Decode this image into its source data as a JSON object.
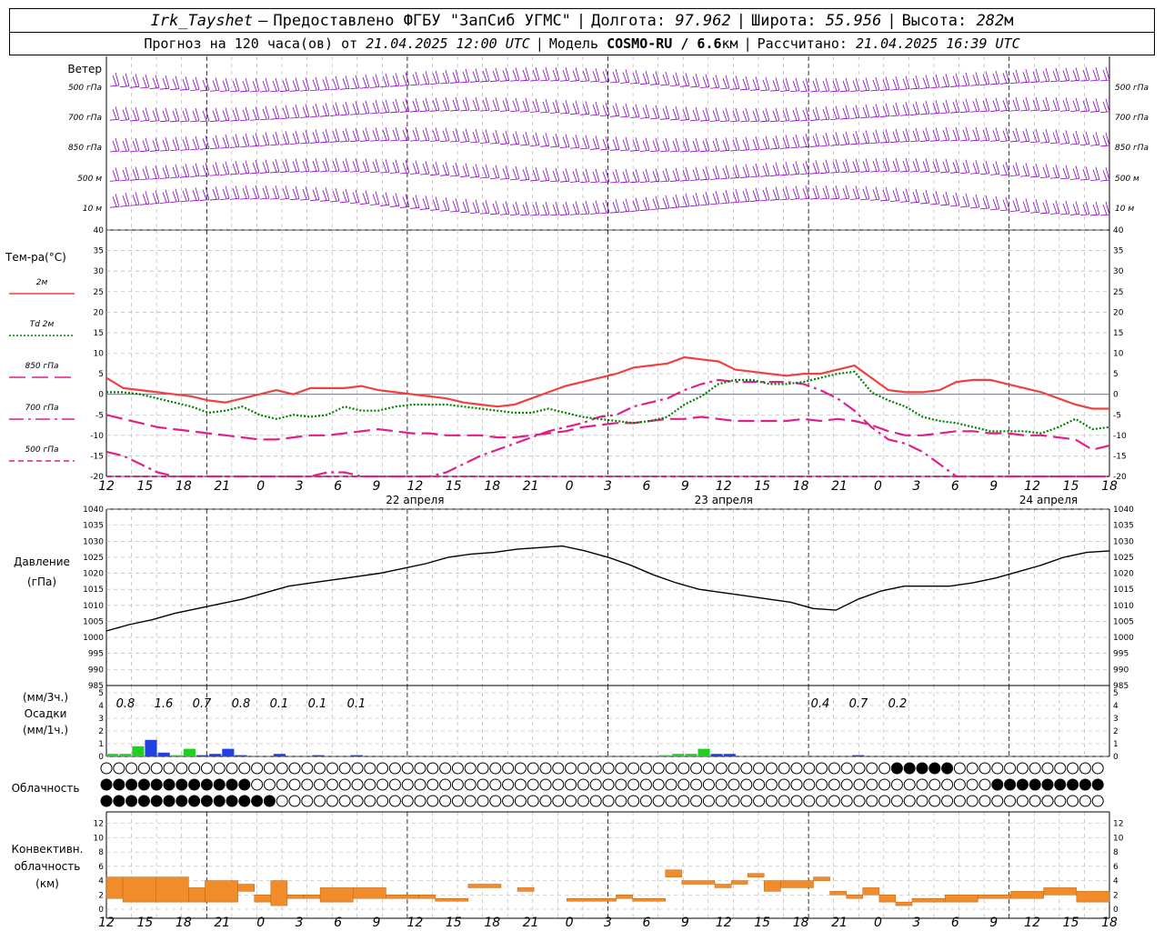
{
  "header": {
    "station": "Irk_Tayshet",
    "dash": "–",
    "provider": "Предоставлено ФГБУ \"ЗапСиб УГМС\"",
    "lon_label": "Долгота:",
    "lon": "97.962",
    "lat_label": "Широта:",
    "lat": "55.956",
    "alt_label": "Высота:",
    "alt": "282",
    "alt_unit": "м",
    "forecast_label": "Прогноз на 120 часа(ов) от",
    "forecast_start": "21.04.2025 12:00 UTC",
    "model_label": "Модель",
    "model": "COSMO-RU / 6.6",
    "model_unit": "км",
    "computed_label": "Рассчитано:",
    "computed": "21.04.2025 16:39 UTC"
  },
  "labels": {
    "wind": "Ветер",
    "levels": [
      "500 гПа",
      "700 гПа",
      "850 гПа",
      "500 м",
      "10 м"
    ],
    "temp": "Тем-ра(°C)",
    "legend": [
      {
        "name": "2м",
        "color": "#f04040",
        "dash": "solid"
      },
      {
        "name": "Td 2м",
        "color": "#008000",
        "dash": "dot"
      },
      {
        "name": "850 гПа",
        "color": "#e0208a",
        "dash": "long"
      },
      {
        "name": "700 гПа",
        "color": "#e0208a",
        "dash": "dashdot"
      },
      {
        "name": "500 гПа",
        "color": "#e0208a",
        "dash": "short"
      }
    ],
    "pressure": [
      "Давление",
      "(гПа)"
    ],
    "precip": [
      "(мм/3ч.)",
      "Осадки",
      "(мм/1ч.)"
    ],
    "cloud": "Облачность",
    "conv": [
      "Конвективн.",
      "облачность",
      "(км)"
    ],
    "dates": [
      "22 апреля",
      "23 апреля",
      "24 апреля"
    ]
  },
  "colors": {
    "wind": "#8a00c8",
    "pressure": "#000000",
    "precip_green": "#20d020",
    "precip_blue": "#2040e0",
    "conv": "#f08c2a"
  },
  "chart_data": {
    "type": "line",
    "x_hours": [
      "12",
      "15",
      "18",
      "21",
      "0",
      "3",
      "6",
      "9",
      "12",
      "15",
      "18",
      "21",
      "0",
      "3",
      "6",
      "9",
      "12",
      "15",
      "18",
      "21",
      "0",
      "3",
      "6",
      "9",
      "12",
      "15",
      "18"
    ],
    "temperature": {
      "ylim": [
        -20,
        40
      ],
      "ticks": [
        40,
        35,
        30,
        25,
        20,
        15,
        10,
        5,
        0,
        -5,
        -10,
        -15,
        -20
      ],
      "t2m": [
        4,
        1.5,
        1,
        0.5,
        0,
        -0.5,
        -1.5,
        -2,
        -1,
        0,
        1,
        0,
        1.5,
        1.5,
        1.5,
        2,
        1,
        0.5,
        0,
        -0.5,
        -1,
        -2,
        -2.5,
        -3,
        -2.5,
        -1,
        0.5,
        2,
        3,
        4,
        5,
        6.5,
        7,
        7.5,
        9,
        8.5,
        8,
        6,
        5.5,
        5,
        4.5,
        5,
        5,
        6,
        7,
        4,
        1,
        0.5,
        0.5,
        1,
        3,
        3.5,
        3.5,
        2.5,
        1.5,
        0.5,
        -1,
        -2.5,
        -3.5,
        -3.5
      ],
      "td2m": [
        0.5,
        0.5,
        0,
        -1,
        -2,
        -3,
        -4.5,
        -4,
        -3,
        -5,
        -6,
        -5,
        -5.5,
        -5,
        -3,
        -4,
        -4,
        -3,
        -2.5,
        -2.5,
        -2.5,
        -3,
        -3.5,
        -4,
        -4.5,
        -4.5,
        -3.5,
        -4.5,
        -5.5,
        -6,
        -6.5,
        -7,
        -6.5,
        -5.5,
        -2.5,
        -0.5,
        2.5,
        3.5,
        3.5,
        2.5,
        2.5,
        3,
        4,
        5,
        5.5,
        0.5,
        -1.5,
        -3,
        -5.5,
        -6.5,
        -7,
        -8,
        -9,
        -9,
        -9,
        -9.5,
        -8,
        -6,
        -8.5,
        -8
      ],
      "t850": [
        -5,
        -6,
        -7,
        -8,
        -8.5,
        -9,
        -9.5,
        -10,
        -10.5,
        -11,
        -11,
        -10.5,
        -10,
        -10,
        -9.5,
        -9,
        -8.5,
        -9,
        -9.5,
        -9.5,
        -10,
        -10,
        -10,
        -10.5,
        -10.5,
        -10,
        -9.5,
        -9,
        -8,
        -7.5,
        -7,
        -7,
        -6.5,
        -6,
        -6,
        -5.5,
        -6,
        -6.5,
        -6.5,
        -6.5,
        -6.5,
        -6,
        -6.5,
        -6,
        -6.5,
        -7.5,
        -9,
        -10,
        -10,
        -9.5,
        -9,
        -9,
        -9.5,
        -9.5,
        -10,
        -10,
        -10.5,
        -11,
        -13.5,
        -12.5
      ],
      "t700": [
        -14,
        -15,
        -17,
        -19,
        -20,
        -20.5,
        -21,
        -21.5,
        -22,
        -22.5,
        -23,
        -22,
        -20,
        -19,
        -19,
        -20,
        -21,
        -22,
        -22.5,
        -21.5,
        -19,
        -17,
        -15,
        -13.5,
        -12,
        -10.5,
        -9,
        -8,
        -7,
        -5.5,
        -5,
        -3,
        -2,
        -1,
        1,
        2.5,
        3.5,
        3,
        3,
        3,
        3,
        2.5,
        1,
        -1,
        -4,
        -8,
        -11,
        -12,
        -14,
        -17,
        -20,
        -22,
        -23,
        -24,
        -25,
        -26,
        -27,
        -28,
        -29,
        -30
      ],
      "t500": [
        -30,
        -31,
        -31,
        -32,
        -32,
        -32.5,
        -33,
        -33,
        -33,
        -33,
        -33,
        -33,
        -33,
        -32.5,
        -32,
        -31.5,
        -31,
        -30.5,
        -30,
        -29,
        -28,
        -27,
        -26,
        -25,
        -24,
        -23,
        -22,
        -22,
        -21.5,
        -21,
        -21,
        -21,
        -21,
        -21,
        -21,
        -21,
        -21,
        -21.5,
        -22,
        -22,
        -22.5,
        -23,
        -23,
        -23.5,
        -24,
        -24.5,
        -25,
        -25.5,
        -26,
        -26.5,
        -27,
        -27.5,
        -28,
        -28.5,
        -29,
        -29.5,
        -30,
        -30,
        -30.5,
        -31
      ]
    },
    "pressure": {
      "ylim": [
        985,
        1040
      ],
      "ticks": [
        1040,
        1035,
        1030,
        1025,
        1020,
        1015,
        1010,
        1005,
        1000,
        995,
        990,
        985
      ],
      "values": [
        1002,
        1004,
        1005.5,
        1007.5,
        1009,
        1010.5,
        1012,
        1014,
        1016,
        1017,
        1018,
        1019,
        1020,
        1021.5,
        1023,
        1025,
        1026,
        1026.5,
        1027.5,
        1028,
        1028.5,
        1027,
        1025,
        1022.5,
        1019.5,
        1017,
        1015,
        1014,
        1013,
        1012,
        1011,
        1009,
        1008.5,
        1012,
        1014.5,
        1016,
        1016,
        1016,
        1017,
        1018.5,
        1020.5,
        1022.5,
        1025,
        1026.5,
        1027
      ]
    },
    "precip": {
      "ylim": [
        0,
        5
      ],
      "labels_3h": [
        "0.8",
        "1.6",
        "0.7",
        "0.8",
        "0.1",
        "0.1",
        "0.1",
        "0.4",
        "0.7",
        "0.2"
      ],
      "bars": [
        [
          0,
          0.2,
          "g"
        ],
        [
          1,
          0.2,
          "g"
        ],
        [
          2,
          0.8,
          "g"
        ],
        [
          3,
          1.3,
          "b"
        ],
        [
          4,
          0.3,
          "b"
        ],
        [
          5,
          0.1,
          "g"
        ],
        [
          6,
          0.6,
          "g"
        ],
        [
          7,
          0.1,
          "b"
        ],
        [
          8,
          0.2,
          "b"
        ],
        [
          9,
          0.6,
          "b"
        ],
        [
          10,
          0.1,
          "b"
        ],
        [
          13,
          0.2,
          "b"
        ],
        [
          16,
          0.1,
          "b"
        ],
        [
          19,
          0.1,
          "b"
        ],
        [
          43,
          0.1,
          "g"
        ],
        [
          44,
          0.2,
          "g"
        ],
        [
          45,
          0.2,
          "g"
        ],
        [
          46,
          0.6,
          "g"
        ],
        [
          47,
          0.2,
          "b"
        ],
        [
          48,
          0.2,
          "b"
        ],
        [
          58,
          0.1,
          "b"
        ]
      ],
      "ticks": [
        5,
        4,
        3,
        2,
        1,
        0
      ]
    },
    "conv_cloud": {
      "ylim": [
        0,
        14
      ],
      "ticks": [
        12,
        10,
        8,
        6,
        4,
        2,
        0
      ],
      "segments": [
        [
          0,
          1,
          1.5,
          4.5
        ],
        [
          1,
          3,
          1,
          4.5
        ],
        [
          3,
          5,
          1,
          4.5
        ],
        [
          5,
          6,
          1,
          3
        ],
        [
          6,
          8,
          1,
          4
        ],
        [
          8,
          9,
          2.5,
          3.5
        ],
        [
          9,
          10,
          1,
          2
        ],
        [
          10,
          11,
          0.5,
          4
        ],
        [
          11,
          12,
          1.5,
          2
        ],
        [
          12,
          13,
          1.5,
          2
        ],
        [
          13,
          15,
          1,
          3
        ],
        [
          15,
          17,
          1.5,
          3
        ],
        [
          17,
          19,
          1.5,
          2
        ],
        [
          19,
          20,
          1.5,
          2
        ],
        [
          20,
          22,
          1.5,
          1.5
        ],
        [
          22,
          24,
          3,
          3.5
        ],
        [
          25,
          26,
          2.5,
          3
        ],
        [
          28,
          31,
          1.5,
          1.5
        ],
        [
          31,
          32,
          1.5,
          2
        ],
        [
          32,
          34,
          1.5,
          1.5
        ],
        [
          34,
          35,
          4.5,
          5.5
        ],
        [
          35,
          37,
          3.5,
          4
        ],
        [
          37,
          38,
          3,
          3.5
        ],
        [
          38,
          39,
          3.5,
          4
        ],
        [
          39,
          40,
          4.5,
          5
        ],
        [
          40,
          41,
          2.5,
          4
        ],
        [
          41,
          43,
          3,
          4
        ],
        [
          43,
          44,
          4,
          4.5
        ],
        [
          44,
          45,
          2,
          2.5
        ],
        [
          45,
          46,
          1.5,
          2
        ],
        [
          46,
          47,
          2,
          3
        ],
        [
          47,
          48,
          1,
          2
        ],
        [
          48,
          49,
          0.5,
          1
        ],
        [
          49,
          51,
          1,
          1.5
        ],
        [
          51,
          53,
          1,
          2
        ],
        [
          53,
          55,
          1.5,
          2
        ],
        [
          55,
          57,
          1.5,
          2.5
        ],
        [
          57,
          59,
          2,
          3
        ],
        [
          59,
          61,
          1,
          2.5
        ]
      ]
    }
  }
}
